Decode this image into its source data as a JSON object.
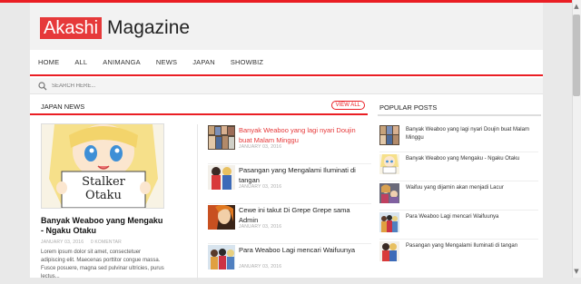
{
  "logo": {
    "box": "Akashi",
    "text": "Magazine"
  },
  "nav": [
    "HOME",
    "ALL",
    "ANIMANGA",
    "NEWS",
    "JAPAN",
    "SHOWBIZ"
  ],
  "search": {
    "placeholder": "SEARCH HERE..."
  },
  "section": {
    "title": "JAPAN NEWS",
    "view_all": "VIEW ALL"
  },
  "featured": {
    "image_text": "Stalker Otaku",
    "title": "Banyak Weaboo yang Mengaku - Ngaku Otaku",
    "date": "JANUARY 03, 2016",
    "comments": "0 KOMENTAR",
    "excerpt": "Lorem ipsum dolor sit amet, consectetuer adipiscing elit. Maecenas porttitor congue massa. Fusce posuere, magna sed pulvinar ultricies, purus lectus..."
  },
  "news": [
    {
      "title": "Banyak Weaboo yang lagi nyari Doujin buat Malam Minggu",
      "date": "JANUARY 03, 2016",
      "highlight": true
    },
    {
      "title": "Pasangan yang Mengalami Iluminati di tangan",
      "date": "JANUARY 03, 2016",
      "highlight": false
    },
    {
      "title": "Cewe ini takut Di Grepe Grepe sama Admin",
      "date": "JANUARY 03, 2016",
      "highlight": false
    },
    {
      "title": "Para Weaboo Lagi mencari Waifuunya",
      "date": "JANUARY 03, 2016",
      "highlight": false
    }
  ],
  "popular": {
    "title": "POPULAR POSTS",
    "items": [
      "Banyak Weaboo yang lagi nyari Doujin buat Malam Minggu",
      "Banyak Weaboo yang Mengaku - Ngaku Otaku",
      "Waifuu yang dijamin akan menjadi Lacur",
      "Para Weaboo Lagi mencari Waifuunya",
      "Pasangan yang Mengalami Iluminati di tangan"
    ]
  },
  "colors": {
    "accent": "#ea1e24",
    "logo_box": "#e6393a"
  }
}
